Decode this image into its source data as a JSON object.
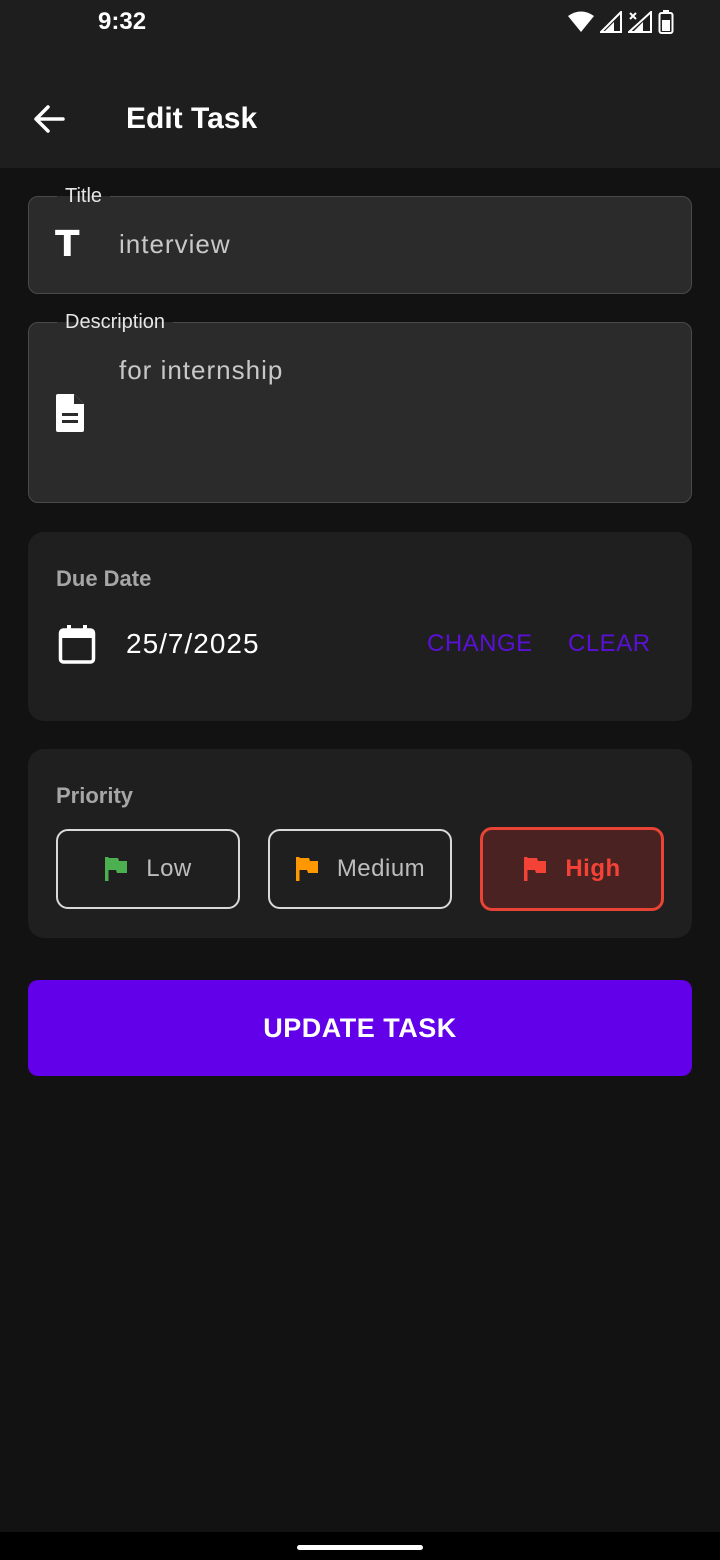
{
  "status_bar": {
    "time": "9:32",
    "icons": [
      "wifi-icon",
      "signal-icon",
      "signal-no-data-icon",
      "battery-icon"
    ]
  },
  "app_bar": {
    "back_icon": "arrow-back-icon",
    "title": "Edit Task"
  },
  "form": {
    "title_field": {
      "label": "Title",
      "value": "interview",
      "icon": "title-icon"
    },
    "description_field": {
      "label": "Description",
      "value": "for internship",
      "icon": "document-icon"
    }
  },
  "due_date": {
    "heading": "Due Date",
    "icon": "calendar-icon",
    "value": "25/7/2025",
    "change_label": "CHANGE",
    "clear_label": "CLEAR"
  },
  "priority": {
    "heading": "Priority",
    "selected": "High",
    "options": [
      {
        "label": "Low",
        "color": "#4caf50"
      },
      {
        "label": "Medium",
        "color": "#ff9800"
      },
      {
        "label": "High",
        "color": "#f44336"
      }
    ]
  },
  "update_button": {
    "label": "UPDATE TASK",
    "color": "#6200ea"
  },
  "colors": {
    "background": "#121212",
    "surface": "#1f1f1f",
    "accent_text": "#5b10d8"
  }
}
